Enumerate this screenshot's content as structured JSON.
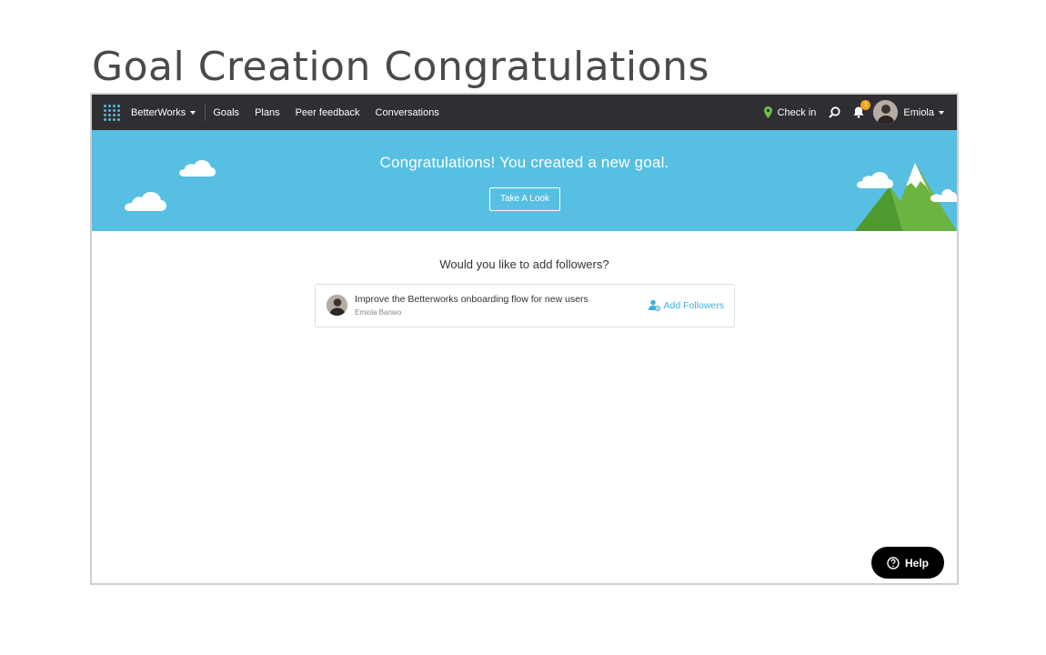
{
  "page": {
    "title": "Goal Creation Congratulations"
  },
  "navbar": {
    "brand": "BetterWorks",
    "links": [
      "Goals",
      "Plans",
      "Peer feedback",
      "Conversations"
    ],
    "checkin_label": "Check in",
    "notification_count": "1",
    "user_name": "Emiola"
  },
  "banner": {
    "message": "Congratulations! You created a new goal.",
    "button_label": "Take A Look",
    "background_color": "#57bfe1"
  },
  "main": {
    "question": "Would you like to add followers?",
    "goal": {
      "title": "Improve the Betterworks onboarding flow for new users",
      "owner": "Emiola Banwo",
      "action_label": "Add Followers"
    }
  },
  "help": {
    "label": "Help"
  },
  "icons": {
    "apps": "grid-icon",
    "checkin": "map-pin-icon",
    "search": "search-icon",
    "notifications": "bell-icon",
    "add_followers": "add-user-icon",
    "help": "question-circle-icon"
  },
  "colors": {
    "navbar": "#2f2f33",
    "accent": "#3fb0dc",
    "pin": "#6cc04a",
    "badge": "#f3a21b",
    "mountain": "#6db33f"
  }
}
